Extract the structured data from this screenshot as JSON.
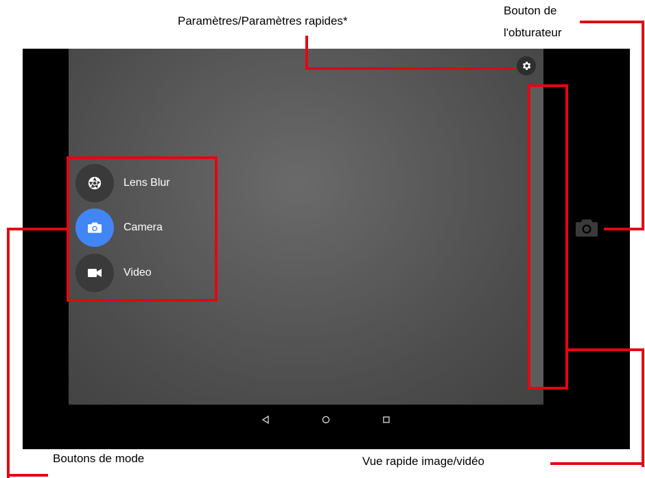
{
  "annotations": {
    "settings": "Paramètres/Paramètres rapides*",
    "shutter_line1": "Bouton de",
    "shutter_line2": "l'obturateur",
    "modes": "Boutons de mode",
    "quickview": "Vue rapide image/vidéo"
  },
  "modes": [
    {
      "label": "Lens Blur",
      "icon": "aperture-icon",
      "active": false
    },
    {
      "label": "Camera",
      "icon": "camera-icon",
      "active": true
    },
    {
      "label": "Video",
      "icon": "video-icon",
      "active": false
    }
  ],
  "colors": {
    "accent": "#4285f4",
    "annotation": "#e30613"
  }
}
